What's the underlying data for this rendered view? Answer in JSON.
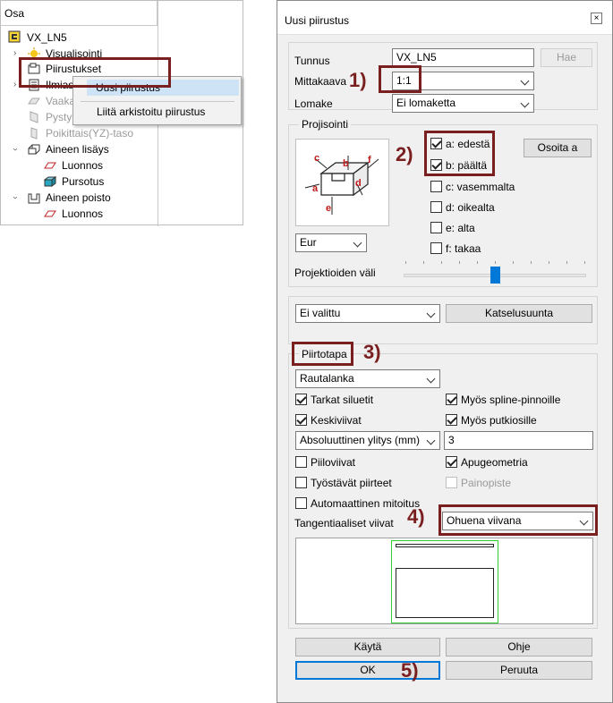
{
  "tree": {
    "header": "Osa",
    "root": "VX_LN5",
    "items": [
      {
        "label": "Visualisointi"
      },
      {
        "label": "Piirustukset"
      },
      {
        "label": "Ilmias"
      },
      {
        "label": "Vaaka"
      },
      {
        "label": "Pysty"
      },
      {
        "label": "Poikittais(YZ)-taso"
      },
      {
        "label": "Aineen lisäys"
      },
      {
        "label": "Luonnos"
      },
      {
        "label": "Pursotus"
      },
      {
        "label": "Aineen poisto"
      },
      {
        "label": "Luonnos"
      }
    ]
  },
  "context_menu": {
    "new_drawing": "Uusi piirustus",
    "attach_drawing": "Liitä arkistoitu piirustus"
  },
  "dialog": {
    "title": "Uusi piirustus",
    "close": "×",
    "tunnus_label": "Tunnus",
    "tunnus_value": "VX_LN5",
    "hae": "Hae",
    "mittakaava_label": "Mittakaava",
    "mittakaava_value": "1:1",
    "lomake_label": "Lomake",
    "lomake_value": "Ei lomaketta",
    "projisointi": {
      "title": "Projisointi",
      "diagram_letters": [
        "a",
        "b",
        "c",
        "d",
        "e",
        "f"
      ],
      "standard": "Eur",
      "osoita": "Osoita a",
      "views": [
        {
          "label": "a: edestä",
          "checked": true
        },
        {
          "label": "b: päältä",
          "checked": true
        },
        {
          "label": "c: vasemmalta",
          "checked": false
        },
        {
          "label": "d: oikealta",
          "checked": false
        },
        {
          "label": "e: alta",
          "checked": false
        },
        {
          "label": "f: takaa",
          "checked": false
        }
      ],
      "spacing_label": "Projektioiden väli",
      "spacing_level": 0.5
    },
    "direction_select": "Ei valittu",
    "katselusuunta": "Katselusuunta",
    "piirtotapa": {
      "title": "Piirtotapa",
      "mode": "Rautalanka",
      "tarkat": "Tarkat siluetit",
      "keskiviivat": "Keskiviivat",
      "spline": "Myös spline-pinnoille",
      "putki": "Myös putkiosille",
      "overlap_mode": "Absoluuttinen ylitys (mm)",
      "overlap_value": "3",
      "piiloviivat": "Piiloviivat",
      "apugeometria": "Apugeometria",
      "tyostavat": "Työstävät piirteet",
      "painopiste": "Painopiste",
      "automaattinen": "Automaattinen mitoitus",
      "tangent_label": "Tangentiaaliset viivat",
      "tangent_value": "Ohuena viivana"
    },
    "kayta": "Käytä",
    "ohje": "Ohje",
    "ok": "OK",
    "peruuta": "Peruuta"
  },
  "markers": [
    "1)",
    "2)",
    "3)",
    "4)",
    "5)"
  ],
  "colors": {
    "annotation": "#7a1f1f",
    "accent": "#0078d7",
    "preview_frame": "#33cc33"
  }
}
